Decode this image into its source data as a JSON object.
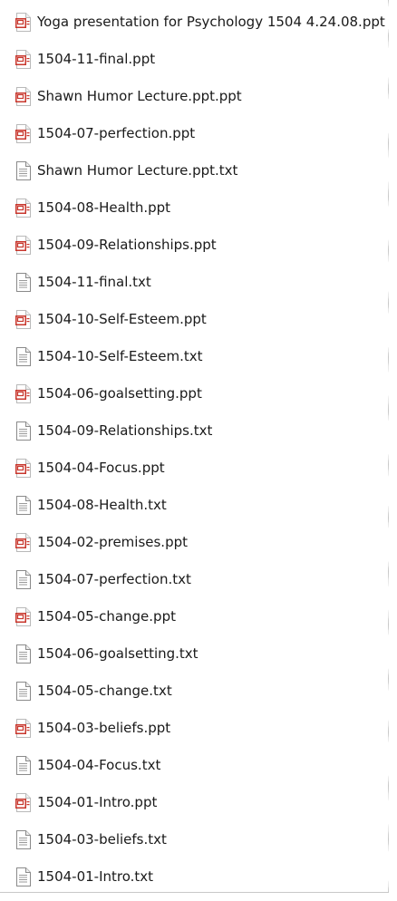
{
  "files": [
    {
      "name": "Yoga presentation for Psychology 1504 4.24.08.ppt",
      "icon": "ppt-file-icon"
    },
    {
      "name": "1504-11-final.ppt",
      "icon": "ppt-file-icon"
    },
    {
      "name": "Shawn Humor Lecture.ppt.ppt",
      "icon": "ppt-file-icon"
    },
    {
      "name": "1504-07-perfection.ppt",
      "icon": "ppt-file-icon"
    },
    {
      "name": "Shawn Humor Lecture.ppt.txt",
      "icon": "text-file-icon"
    },
    {
      "name": "1504-08-Health.ppt",
      "icon": "ppt-file-icon"
    },
    {
      "name": "1504-09-Relationships.ppt",
      "icon": "ppt-file-icon"
    },
    {
      "name": "1504-11-final.txt",
      "icon": "text-file-icon"
    },
    {
      "name": "1504-10-Self-Esteem.ppt",
      "icon": "ppt-file-icon"
    },
    {
      "name": "1504-10-Self-Esteem.txt",
      "icon": "text-file-icon"
    },
    {
      "name": "1504-06-goalsetting.ppt",
      "icon": "ppt-file-icon"
    },
    {
      "name": "1504-09-Relationships.txt",
      "icon": "text-file-icon"
    },
    {
      "name": "1504-04-Focus.ppt",
      "icon": "ppt-file-icon"
    },
    {
      "name": "1504-08-Health.txt",
      "icon": "text-file-icon"
    },
    {
      "name": "1504-02-premises.ppt",
      "icon": "ppt-file-icon"
    },
    {
      "name": "1504-07-perfection.txt",
      "icon": "text-file-icon"
    },
    {
      "name": "1504-05-change.ppt",
      "icon": "ppt-file-icon"
    },
    {
      "name": "1504-06-goalsetting.txt",
      "icon": "text-file-icon"
    },
    {
      "name": "1504-05-change.txt",
      "icon": "text-file-icon"
    },
    {
      "name": "1504-03-beliefs.ppt",
      "icon": "ppt-file-icon"
    },
    {
      "name": "1504-04-Focus.txt",
      "icon": "text-file-icon"
    },
    {
      "name": "1504-01-Intro.ppt",
      "icon": "ppt-file-icon"
    },
    {
      "name": "1504-03-beliefs.txt",
      "icon": "text-file-icon"
    },
    {
      "name": "1504-01-Intro.txt",
      "icon": "text-file-icon"
    }
  ],
  "colors": {
    "ppt_accent": "#c8372d",
    "text_icon_border": "#8a8a8a"
  }
}
